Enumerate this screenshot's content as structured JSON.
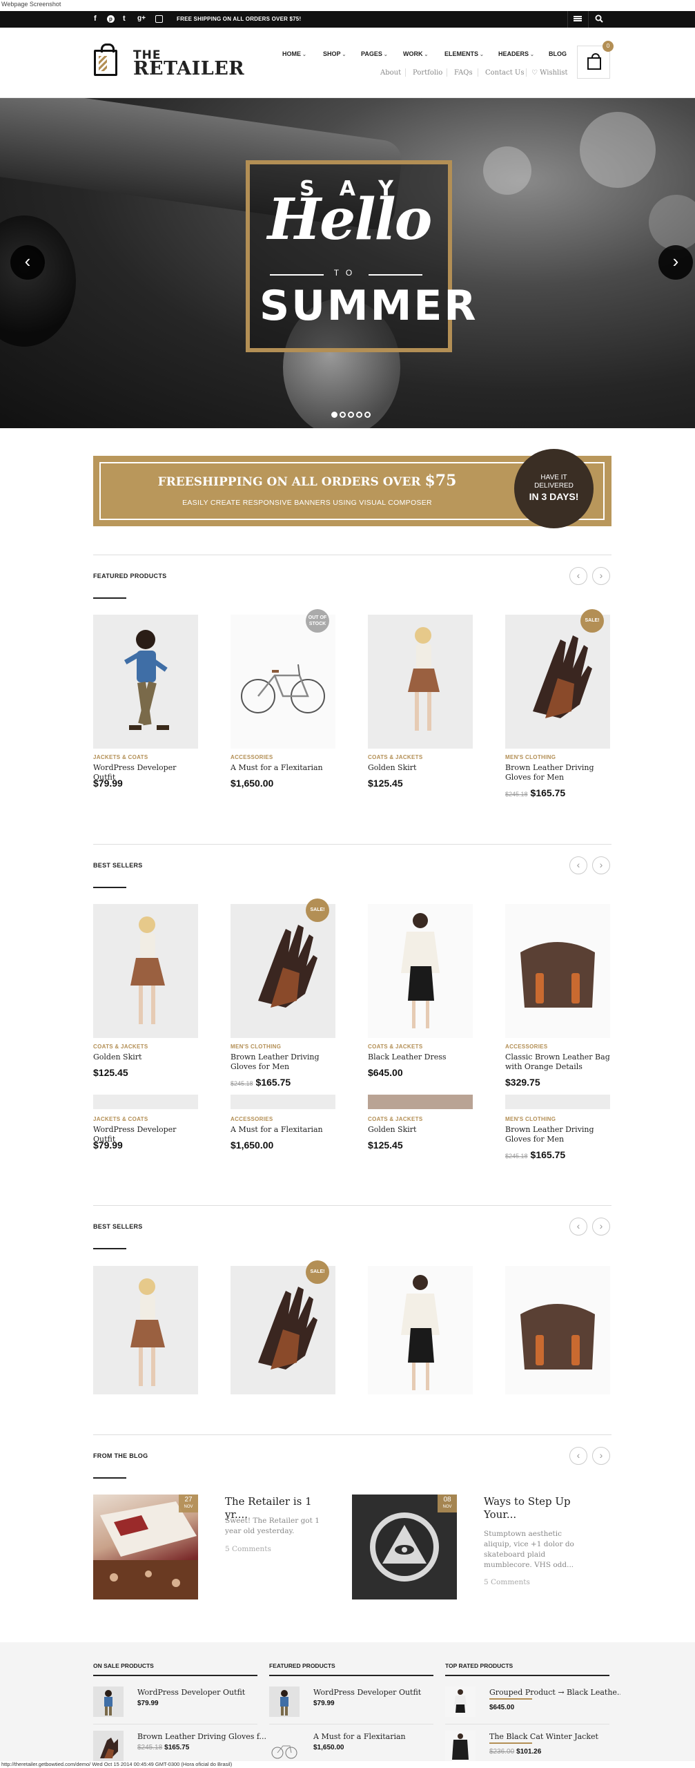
{
  "caption": "Webpage Screenshot",
  "topbar": {
    "shipping_text": "FREE SHIPPING ON ALL ORDERS OVER $75!",
    "social_icons": [
      "facebook-icon",
      "pinterest-icon",
      "twitter-icon",
      "google-plus-icon",
      "instagram-icon"
    ],
    "menu_icon": "menu-icon",
    "search_icon": "search-icon"
  },
  "logo": {
    "line1": "THE",
    "line2": "RETAILER"
  },
  "nav": {
    "items": [
      {
        "label": "HOME",
        "dropdown": true
      },
      {
        "label": "SHOP",
        "dropdown": true
      },
      {
        "label": "PAGES",
        "dropdown": true
      },
      {
        "label": "WORK",
        "dropdown": true
      },
      {
        "label": "ELEMENTS",
        "dropdown": true
      },
      {
        "label": "HEADERS",
        "dropdown": true
      },
      {
        "label": "BLOG",
        "dropdown": false
      }
    ],
    "sub_items": [
      "About",
      "Portfolio",
      "FAQs",
      "Contact Us",
      "♡ Wishlist"
    ],
    "cart_count": "0"
  },
  "hero": {
    "say": "SAY",
    "hello": "Hello",
    "to": "TO",
    "summer": "SUMMER",
    "prev": "‹",
    "next": "›",
    "slides": 5,
    "active_slide": 1
  },
  "banner": {
    "headline_prefix": "FREESHIPPING ON ALL ORDERS OVER ",
    "headline_amount": "$75",
    "subline": "EASILY CREATE RESPONSIVE BANNERS USING VISUAL COMPOSER",
    "circle": {
      "l1": "HAVE IT",
      "l2": "DELIVERED",
      "l3": "IN 3 DAYS!"
    }
  },
  "featured": {
    "title": "FEATURED PRODUCTS",
    "products": [
      {
        "category": "JACKETS & COATS",
        "name": "WordPress Developer Outfit",
        "price": "$79.99",
        "old_price": "",
        "badge": ""
      },
      {
        "category": "ACCESSORIES",
        "name": "A Must for a Flexitarian",
        "price": "$1,650.00",
        "old_price": "",
        "badge": "OUT OF STOCK"
      },
      {
        "category": "COATS & JACKETS",
        "name": "Golden Skirt",
        "price": "$125.45",
        "old_price": "",
        "badge": ""
      },
      {
        "category": "MEN'S CLOTHING",
        "name": "Brown Leather Driving Gloves for Men",
        "price": "$165.75",
        "old_price": "$245.18",
        "badge": "SALE!"
      }
    ]
  },
  "best1": {
    "title": "BEST SELLERS",
    "products": [
      {
        "category": "COATS & JACKETS",
        "name": "Golden Skirt",
        "price": "$125.45",
        "old_price": ""
      },
      {
        "category": "MEN'S CLOTHING",
        "name": "Brown Leather Driving Gloves for Men",
        "price": "$165.75",
        "old_price": "$245.18",
        "badge": "SALE!"
      },
      {
        "category": "COATS & JACKETS",
        "name": "Black Leather Dress",
        "price": "$645.00",
        "old_price": ""
      },
      {
        "category": "ACCESSORIES",
        "name": "Classic Brown Leather Bag with Orange Details",
        "price": "$329.75",
        "old_price": ""
      }
    ],
    "row2": [
      {
        "category": "JACKETS & COATS",
        "name": "WordPress Developer Outfit",
        "price": "$79.99",
        "old_price": ""
      },
      {
        "category": "ACCESSORIES",
        "name": "A Must for a Flexitarian",
        "price": "$1,650.00",
        "old_price": ""
      },
      {
        "category": "COATS & JACKETS",
        "name": "Golden Skirt",
        "price": "$125.45",
        "old_price": ""
      },
      {
        "category": "MEN'S CLOTHING",
        "name": "Brown Leather Driving Gloves for Men",
        "price": "$165.75",
        "old_price": "$245.18"
      }
    ]
  },
  "best2": {
    "title": "BEST SELLERS",
    "badge": "SALE!"
  },
  "blog": {
    "title": "FROM THE BLOG",
    "posts": [
      {
        "day": "27",
        "month": "NOV",
        "title": "The Retailer is 1 yr....",
        "excerpt": "Sweet! The Retailer got 1 year old yesterday.",
        "comments": "5 Comments"
      },
      {
        "day": "08",
        "month": "NOV",
        "title": "Ways to Step Up Your...",
        "excerpt": "Stumptown aesthetic aliquip, vice +1 dolor do skateboard plaid mumblecore. VHS odd...",
        "comments": "5 Comments"
      }
    ]
  },
  "footer": {
    "on_sale": {
      "title": "ON SALE PRODUCTS",
      "items": [
        {
          "name": "WordPress Developer Outfit",
          "price": "$79.99",
          "old_price": ""
        },
        {
          "name": "Brown Leather Driving Gloves f...",
          "price": "$165.75",
          "old_price": "$245.18"
        }
      ]
    },
    "featured": {
      "title": "FEATURED PRODUCTS",
      "items": [
        {
          "name": "WordPress Developer Outfit",
          "price": "$79.99",
          "old_price": ""
        },
        {
          "name": "A Must for a Flexitarian",
          "price": "$1,650.00",
          "old_price": ""
        }
      ]
    },
    "top_rated": {
      "title": "TOP RATED PRODUCTS",
      "items": [
        {
          "name": "Grouped Product → Black Leathe...",
          "price": "$645.00",
          "old_price": ""
        },
        {
          "name": "The Black Cat Winter Jacket",
          "price": "$101.26",
          "old_price": "$236.00"
        }
      ]
    }
  },
  "status_bar": "http://theretailer.getbowtied.com/demo/ Wed Oct 15 2014 00:45:49 GMT-0300 (Hora oficial do Brasil)",
  "colors": {
    "accent": "#b38f55",
    "dark": "#111111",
    "circle": "#3a2e24"
  }
}
